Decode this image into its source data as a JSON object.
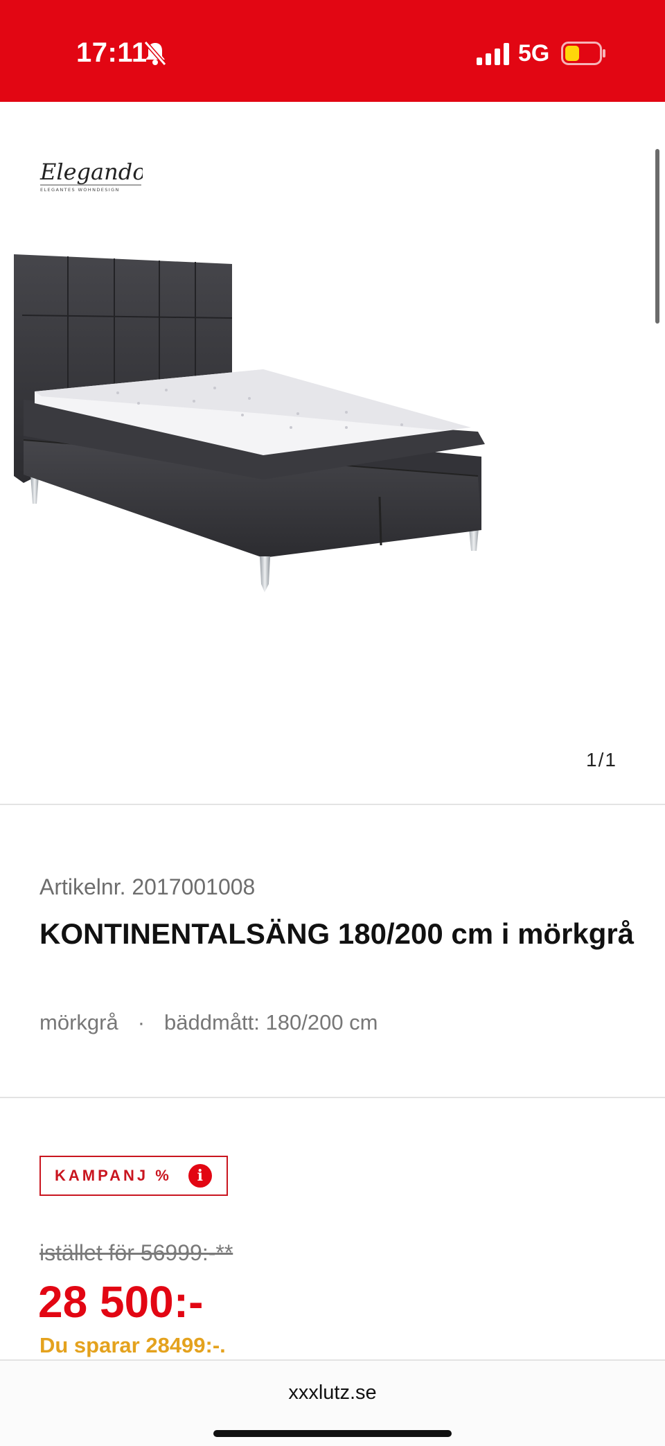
{
  "status_bar": {
    "time": "17:11",
    "network": "5G",
    "bell_icon": "bell-slash-icon",
    "signal_icon": "cellular-signal-icon",
    "battery_icon": "battery-low-power-icon",
    "background_color": "#e20613"
  },
  "gallery": {
    "brand_logo": "Elegando",
    "brand_tagline": "ELEGANTES WOHNDESIGN",
    "image_counter": "1/1"
  },
  "product": {
    "article_number": "Artikelnr. 2017001008",
    "title_bold": "KONTINENTALSÄNG",
    "title_rest": "180/200 cm i mörkgrå",
    "color": "mörkgrå",
    "separator": "·",
    "bed_size": "bäddmått: 180/200 cm"
  },
  "price": {
    "campaign_label": "KAMPANJ %",
    "info_icon": "i",
    "old_price": "istället för 56999:-**",
    "current_price": "28 500:-",
    "savings": "Du sparar 28499:-.",
    "price_color": "#e20613",
    "savings_color": "#e4a21e"
  },
  "browser": {
    "url": "xxxlutz.se"
  }
}
